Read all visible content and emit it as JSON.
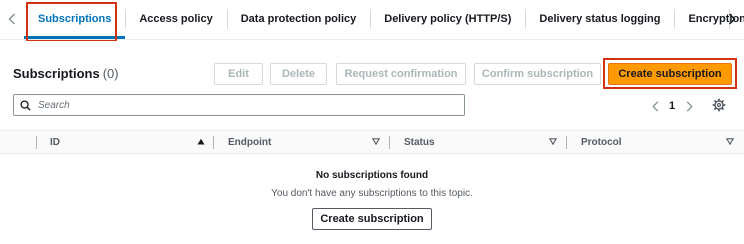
{
  "tabs": [
    {
      "label": "Subscriptions",
      "active": true
    },
    {
      "label": "Access policy",
      "active": false
    },
    {
      "label": "Data protection policy",
      "active": false
    },
    {
      "label": "Delivery policy (HTTP/S)",
      "active": false
    },
    {
      "label": "Delivery status logging",
      "active": false
    },
    {
      "label": "Encryption",
      "active": false
    }
  ],
  "panel": {
    "title": "Subscriptions",
    "count": "(0)"
  },
  "actions": {
    "edit": "Edit",
    "delete": "Delete",
    "request_confirmation": "Request confirmation",
    "confirm_subscription": "Confirm subscription",
    "create_subscription": "Create subscription"
  },
  "search": {
    "placeholder": "Search"
  },
  "pagination": {
    "current_page": "1"
  },
  "table": {
    "columns": [
      "ID",
      "Endpoint",
      "Status",
      "Protocol"
    ]
  },
  "empty_state": {
    "title": "No subscriptions found",
    "description": "You don't have any subscriptions to this topic.",
    "button": "Create subscription"
  },
  "colors": {
    "primary_button": "#ff9900",
    "active_tab": "#0073bb",
    "highlight_box": "#d13212"
  },
  "icons": {
    "tab_scroll_left": "chevron-left-icon",
    "tab_scroll_right": "chevron-right-icon",
    "search": "search-icon",
    "page_prev": "chevron-left-icon",
    "page_next": "chevron-right-icon",
    "settings": "gear-icon",
    "sort_ascending": "triangle-up-icon",
    "sort_descending": "triangle-down-icon"
  }
}
